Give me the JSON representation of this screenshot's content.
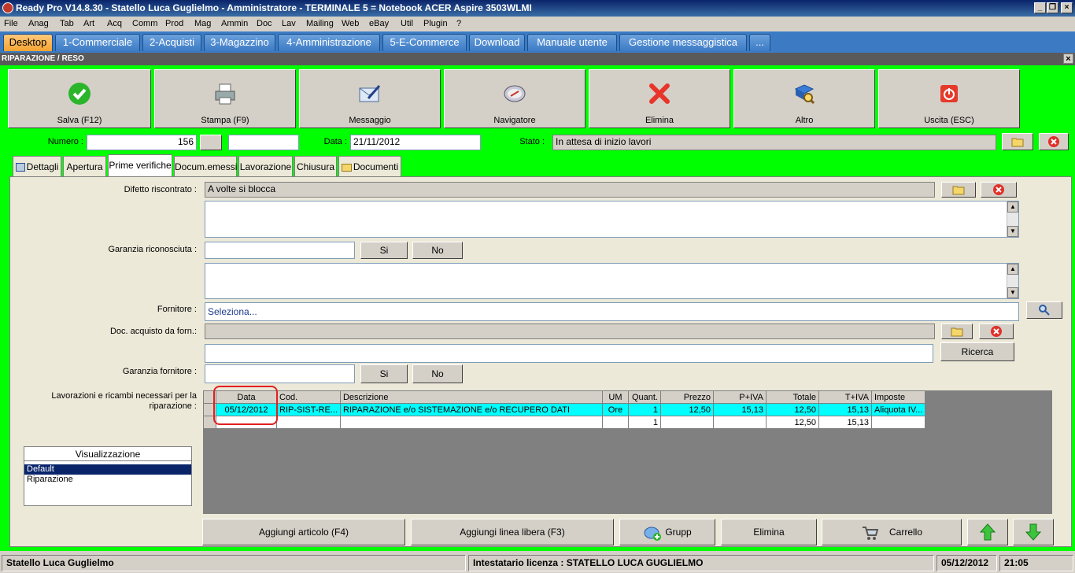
{
  "title": "Ready Pro V14.8.30 - Statello Luca Guglielmo - Amministratore - TERMINALE 5 = Notebook ACER Aspire 3503WLMI",
  "menu": [
    "File",
    "Anag",
    "Tab",
    "Art",
    "Acq",
    "Comm",
    "Prod",
    "Mag",
    "Ammin",
    "Doc",
    "Lav",
    "Mailing",
    "Web",
    "eBay",
    "Util",
    "Plugin",
    "?"
  ],
  "tabs": [
    "Desktop",
    "1-Commerciale",
    "2-Acquisti",
    "3-Magazzino",
    "4-Amministrazione",
    "5-E-Commerce",
    "Download",
    "Manuale utente",
    "Gestione messaggistica",
    "..."
  ],
  "form_title": "RIPARAZIONE / RESO",
  "toolbar": [
    "Salva (F12)",
    "Stampa (F9)",
    "Messaggio",
    "Navigatore",
    "Elimina",
    "Altro",
    "Uscita (ESC)"
  ],
  "header": {
    "numero_label": "Numero :",
    "numero": "156",
    "data_label": "Data :",
    "data": "21/11/2012",
    "stato_label": "Stato :",
    "stato": "In attesa di inizio lavori"
  },
  "form_tabs": [
    "Dettagli",
    "Apertura",
    "Prime verifiche",
    "Docum.emessi",
    "Lavorazione",
    "Chiusura",
    "Documenti"
  ],
  "fields": {
    "difetto_label": "Difetto riscontrato :",
    "difetto": "A volte si blocca",
    "garanzia_label": "Garanzia riconosciuta :",
    "si": "Si",
    "no": "No",
    "fornitore_label": "Fornitore :",
    "fornitore_placeholder": "Seleziona...",
    "doc_acq_label": "Doc. acquisto da forn.:",
    "ricerca": "Ricerca",
    "garanzia_forn_label": "Garanzia fornitore :",
    "lavorazioni_label": "Lavorazioni e ricambi necessari per la riparazione :"
  },
  "grid": {
    "columns": [
      "",
      "Data",
      "Cod.",
      "Descrizione",
      "UM",
      "Quant.",
      "Prezzo",
      "P+IVA",
      "Totale",
      "T+IVA",
      "Imposte"
    ],
    "rows": [
      [
        "",
        "05/12/2012",
        "RIP-SIST-RE...",
        "RIPARAZIONE e/o SISTEMAZIONE e/o RECUPERO DATI",
        "Ore",
        "1",
        "12,50",
        "15,13",
        "12,50",
        "15,13",
        "Aliquota IV..."
      ],
      [
        "",
        "",
        "",
        "",
        "",
        "1",
        "",
        "",
        "12,50",
        "15,13",
        ""
      ]
    ]
  },
  "visualizzazione": {
    "title": "Visualizzazione",
    "items": [
      "Default",
      "Riparazione"
    ],
    "selected": "Default"
  },
  "bottom_buttons": [
    "Aggiungi articolo (F4)",
    "Aggiungi linea libera (F3)",
    "Grupp",
    "Elimina",
    "Carrello"
  ],
  "status": {
    "user": "Statello Luca Guglielmo",
    "licenza": "Intestatario licenza : STATELLO LUCA GUGLIELMO",
    "date": "05/12/2012",
    "time": "21:05"
  },
  "colors": {
    "accent_green": "#00ff00",
    "selected_row": "#00ffff",
    "titlebar": "#0a246a",
    "annotation": "#e02020"
  }
}
